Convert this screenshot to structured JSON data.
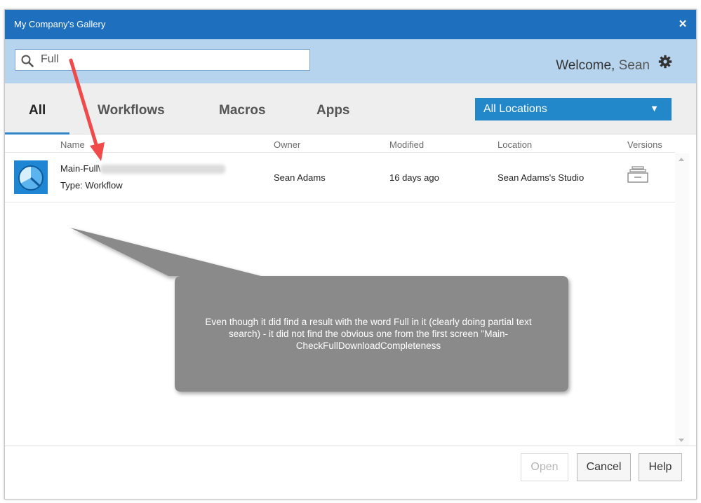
{
  "window": {
    "title": "My Company's Gallery",
    "close_label": "×"
  },
  "search": {
    "value": "Full",
    "placeholder": ""
  },
  "header": {
    "welcome_prefix": "Welcome,",
    "user_name": "Sean"
  },
  "tabs": [
    {
      "label": "All",
      "active": true
    },
    {
      "label": "Workflows",
      "active": false
    },
    {
      "label": "Macros",
      "active": false
    },
    {
      "label": "Apps",
      "active": false
    }
  ],
  "location_filter": {
    "selected": "All Locations"
  },
  "columns": {
    "name": "Name",
    "owner": "Owner",
    "modified": "Modified",
    "location": "Location",
    "versions": "Versions"
  },
  "results": [
    {
      "name": "Main-Full\\",
      "type": "Type: Workflow",
      "owner": "Sean Adams",
      "modified": "16 days ago",
      "location": "Sean Adams's Studio"
    }
  ],
  "buttons": {
    "open": "Open",
    "cancel": "Cancel",
    "help": "Help"
  },
  "annotation": {
    "text": "Even though it did find a result with the word Full in it (clearly doing partial text search) - it did not find the obvious one from the first screen \"Main-CheckFullDownloadCompleteness"
  },
  "colors": {
    "titlebar": "#1e6fbe",
    "searchbar": "#b7d4ef",
    "accent": "#2388c9",
    "arrow": "#f04a4a",
    "callout": "#8a8a8a"
  },
  "icons": [
    "search-icon",
    "gear-icon",
    "close-icon",
    "workflow-icon",
    "versions-icon",
    "chevron-down-icon"
  ]
}
